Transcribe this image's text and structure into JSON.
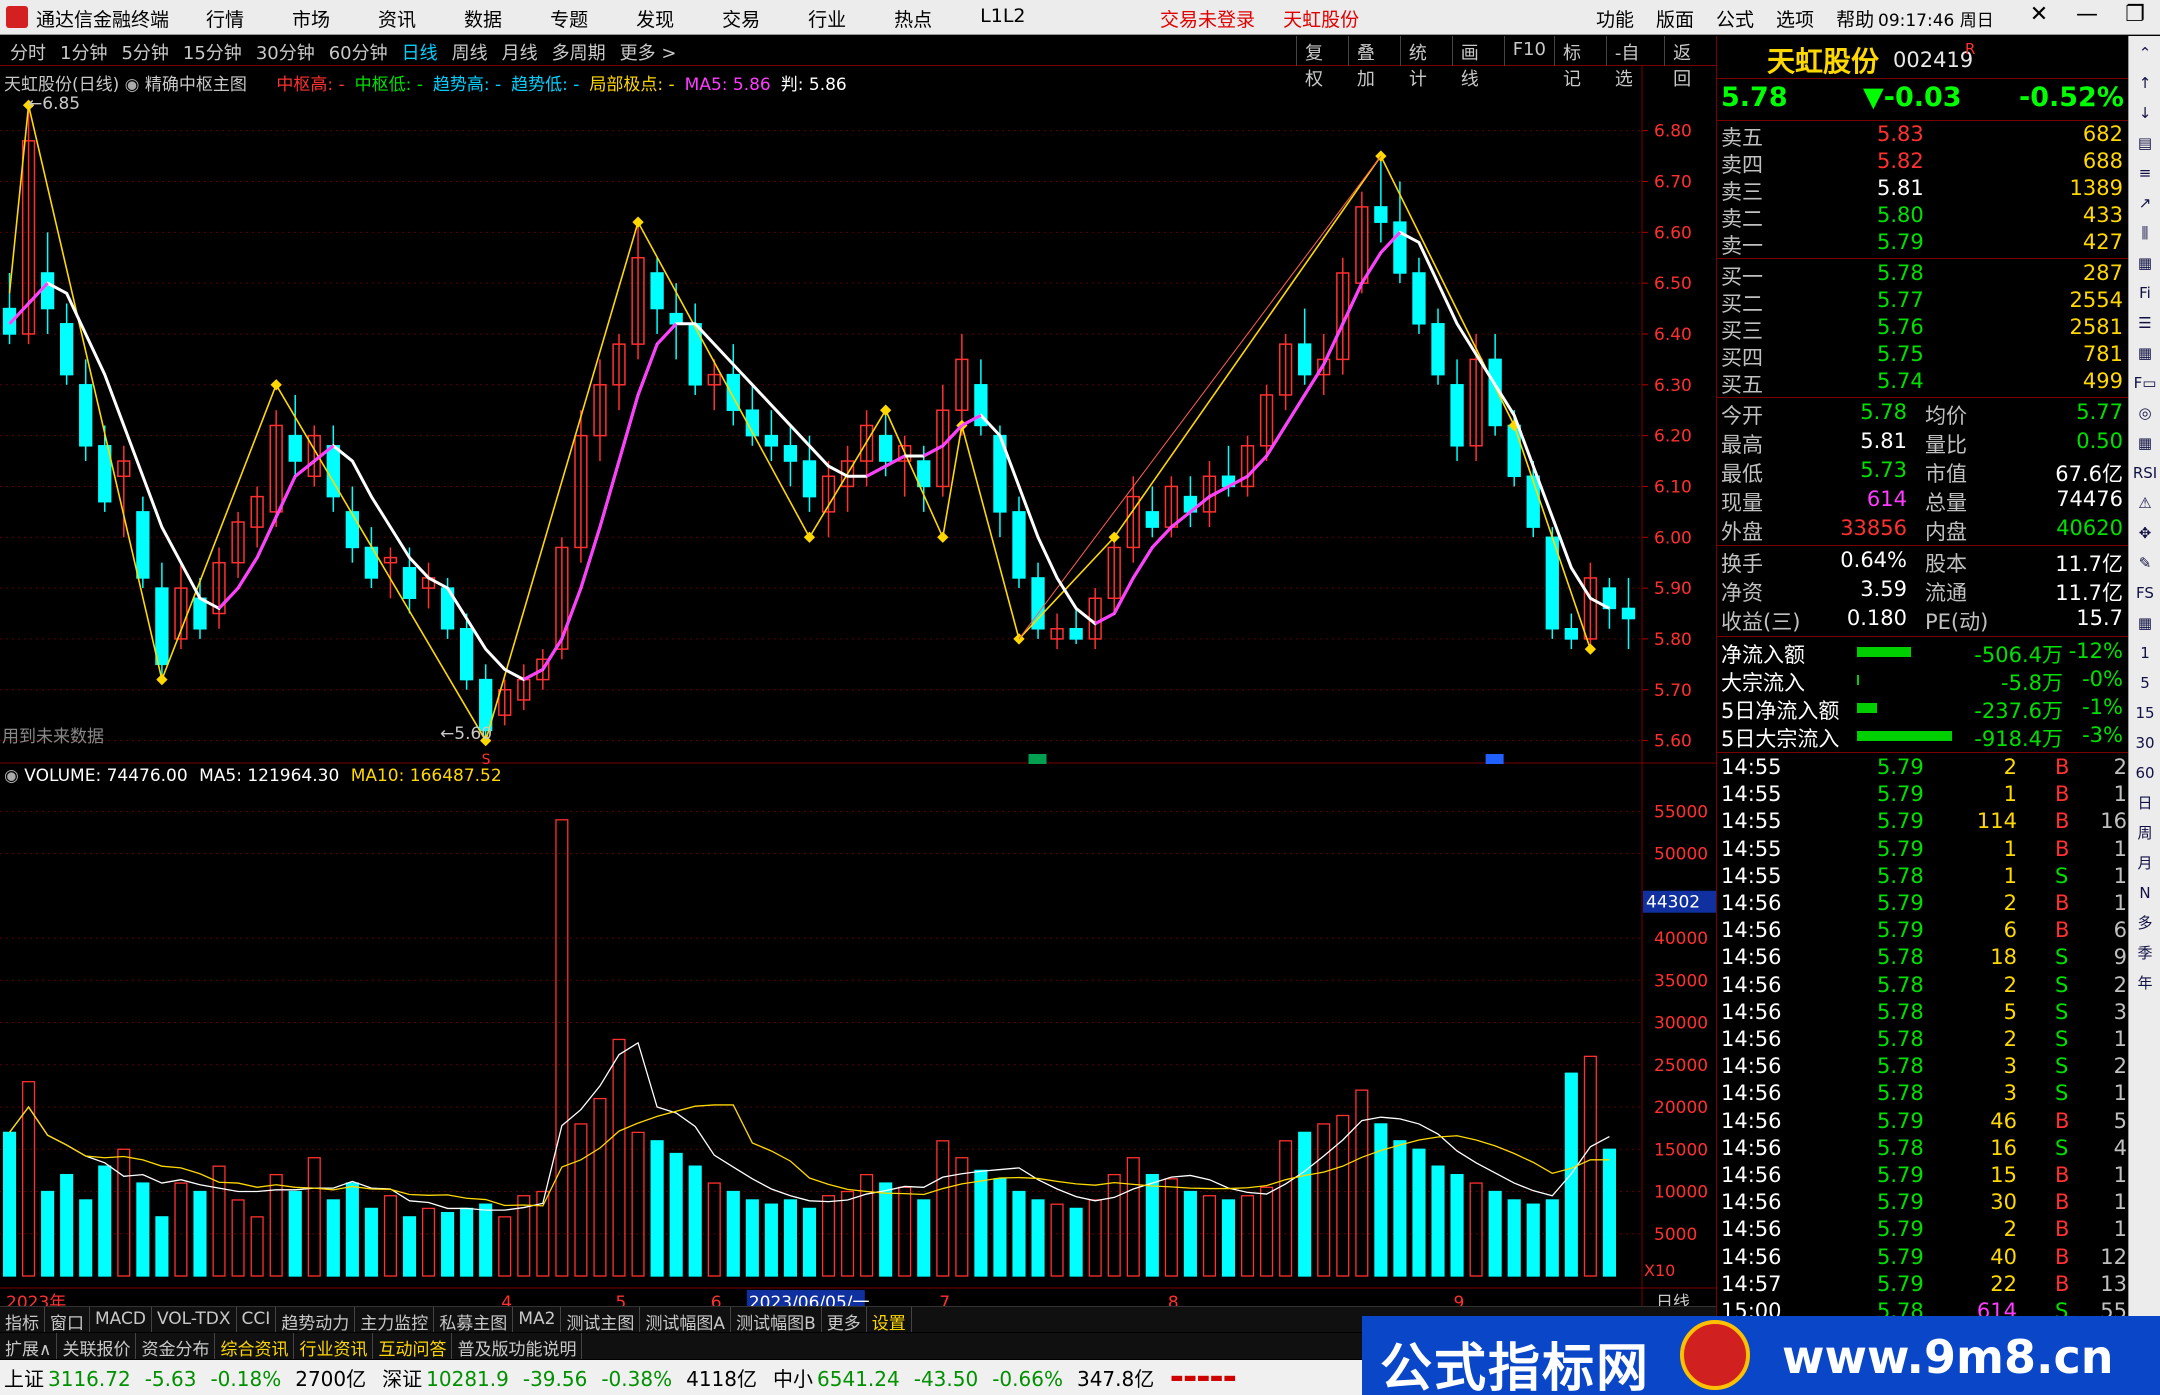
{
  "menubar": {
    "app_title": "通达信金融终端",
    "items": [
      "行情",
      "市场",
      "资讯",
      "数据",
      "专题",
      "发现",
      "交易",
      "行业",
      "热点",
      "L1L2"
    ],
    "status": [
      "交易未登录",
      "天虹股份"
    ],
    "right_items": [
      "功能",
      "版面",
      "公式",
      "选项",
      "帮助"
    ],
    "time": "09:17:46",
    "weekday": "周日",
    "window_controls": [
      "✕",
      "—",
      "❐",
      "✕"
    ]
  },
  "periodbar": {
    "periods": [
      "分时",
      "1分钟",
      "5分钟",
      "15分钟",
      "30分钟",
      "60分钟",
      "日线",
      "周线",
      "月线",
      "多周期",
      "更多 >"
    ],
    "active": "日线",
    "tools": [
      "复权",
      "叠加",
      "统计",
      "画线",
      "F10",
      "标记",
      "-自选",
      "返回"
    ]
  },
  "main_chart": {
    "stock_label": "天虹股份(日线)",
    "indicator_name": "精确中枢主图",
    "legend": [
      {
        "text": "中枢高: -",
        "color": "#ff3030"
      },
      {
        "text": "中枢低: -",
        "color": "#00e000"
      },
      {
        "text": "趋势高: -",
        "color": "#00d0ff"
      },
      {
        "text": "趋势低: -",
        "color": "#00d0ff"
      },
      {
        "text": "局部极点: -",
        "color": "#ffd800"
      },
      {
        "text": "MA5: 5.86",
        "color": "#ff3cff"
      },
      {
        "text": "判: 5.86",
        "color": "#ffffff"
      }
    ],
    "high_mark": "6.85",
    "low_mark": "5.60",
    "future_note": "用到未来数据",
    "price_ticks": [
      "6.80",
      "6.70",
      "6.60",
      "6.50",
      "6.40",
      "6.30",
      "6.20",
      "6.10",
      "6.00",
      "5.90",
      "5.80",
      "5.70",
      "5.60"
    ],
    "markers": [
      "S",
      "B",
      "B"
    ]
  },
  "volume_chart": {
    "label": "VOLUME: 74476.00",
    "ma5": "MA5: 121964.30",
    "ma10": "MA10: 166487.52",
    "vol_ticks": [
      "55000",
      "50000",
      "44302",
      "40000",
      "35000",
      "30000",
      "25000",
      "20000",
      "15000",
      "10000",
      "5000"
    ],
    "unit": "X10",
    "date_labels": [
      "2023年",
      "4",
      "5",
      "6",
      "2023/06/05/一",
      "7",
      "8",
      "9"
    ],
    "period_label": "日线"
  },
  "chart_data": {
    "type": "candlestick",
    "ylim": [
      5.55,
      6.88
    ],
    "candles": [
      [
        6.45,
        6.52,
        6.38,
        6.4
      ],
      [
        6.4,
        6.85,
        6.38,
        6.78
      ],
      [
        6.52,
        6.6,
        6.4,
        6.45
      ],
      [
        6.42,
        6.46,
        6.3,
        6.32
      ],
      [
        6.3,
        6.35,
        6.15,
        6.18
      ],
      [
        6.18,
        6.22,
        6.05,
        6.07
      ],
      [
        6.12,
        6.18,
        6.0,
        6.15
      ],
      [
        6.05,
        6.08,
        5.9,
        5.92
      ],
      [
        5.9,
        5.95,
        5.72,
        5.75
      ],
      [
        5.8,
        5.95,
        5.78,
        5.9
      ],
      [
        5.88,
        5.92,
        5.8,
        5.82
      ],
      [
        5.85,
        5.98,
        5.82,
        5.95
      ],
      [
        5.95,
        6.05,
        5.92,
        6.03
      ],
      [
        6.02,
        6.1,
        5.98,
        6.08
      ],
      [
        6.05,
        6.25,
        6.02,
        6.22
      ],
      [
        6.2,
        6.28,
        6.12,
        6.15
      ],
      [
        6.12,
        6.22,
        6.1,
        6.2
      ],
      [
        6.18,
        6.22,
        6.05,
        6.08
      ],
      [
        6.05,
        6.1,
        5.95,
        5.98
      ],
      [
        5.98,
        6.02,
        5.9,
        5.92
      ],
      [
        5.95,
        5.98,
        5.88,
        5.96
      ],
      [
        5.94,
        5.98,
        5.85,
        5.88
      ],
      [
        5.9,
        5.95,
        5.86,
        5.92
      ],
      [
        5.9,
        5.92,
        5.8,
        5.82
      ],
      [
        5.82,
        5.85,
        5.7,
        5.72
      ],
      [
        5.72,
        5.75,
        5.6,
        5.62
      ],
      [
        5.65,
        5.72,
        5.63,
        5.7
      ],
      [
        5.68,
        5.75,
        5.66,
        5.72
      ],
      [
        5.72,
        5.78,
        5.7,
        5.76
      ],
      [
        5.78,
        6.0,
        5.76,
        5.98
      ],
      [
        5.98,
        6.25,
        5.95,
        6.2
      ],
      [
        6.2,
        6.35,
        6.15,
        6.3
      ],
      [
        6.3,
        6.4,
        6.25,
        6.38
      ],
      [
        6.38,
        6.62,
        6.35,
        6.55
      ],
      [
        6.52,
        6.55,
        6.4,
        6.45
      ],
      [
        6.44,
        6.5,
        6.35,
        6.42
      ],
      [
        6.42,
        6.46,
        6.28,
        6.3
      ],
      [
        6.3,
        6.35,
        6.25,
        6.32
      ],
      [
        6.32,
        6.38,
        6.22,
        6.25
      ],
      [
        6.25,
        6.3,
        6.18,
        6.2
      ],
      [
        6.2,
        6.25,
        6.15,
        6.18
      ],
      [
        6.18,
        6.22,
        6.1,
        6.15
      ],
      [
        6.15,
        6.2,
        6.05,
        6.08
      ],
      [
        6.05,
        6.15,
        6.0,
        6.12
      ],
      [
        6.1,
        6.18,
        6.05,
        6.15
      ],
      [
        6.15,
        6.25,
        6.1,
        6.22
      ],
      [
        6.2,
        6.24,
        6.12,
        6.15
      ],
      [
        6.15,
        6.2,
        6.08,
        6.18
      ],
      [
        6.15,
        6.18,
        6.05,
        6.1
      ],
      [
        6.1,
        6.3,
        6.08,
        6.25
      ],
      [
        6.25,
        6.4,
        6.2,
        6.35
      ],
      [
        6.3,
        6.35,
        6.2,
        6.22
      ],
      [
        6.2,
        6.22,
        6.0,
        6.05
      ],
      [
        6.05,
        6.08,
        5.9,
        5.92
      ],
      [
        5.92,
        5.95,
        5.8,
        5.82
      ],
      [
        5.8,
        5.85,
        5.78,
        5.82
      ],
      [
        5.82,
        5.86,
        5.79,
        5.8
      ],
      [
        5.8,
        5.9,
        5.78,
        5.88
      ],
      [
        5.88,
        6.0,
        5.85,
        5.98
      ],
      [
        5.98,
        6.12,
        5.95,
        6.08
      ],
      [
        6.05,
        6.1,
        6.0,
        6.02
      ],
      [
        6.02,
        6.12,
        6.0,
        6.1
      ],
      [
        6.08,
        6.12,
        6.02,
        6.05
      ],
      [
        6.05,
        6.15,
        6.02,
        6.12
      ],
      [
        6.12,
        6.18,
        6.08,
        6.1
      ],
      [
        6.1,
        6.2,
        6.08,
        6.18
      ],
      [
        6.18,
        6.3,
        6.15,
        6.28
      ],
      [
        6.28,
        6.4,
        6.25,
        6.38
      ],
      [
        6.38,
        6.45,
        6.3,
        6.32
      ],
      [
        6.32,
        6.4,
        6.28,
        6.35
      ],
      [
        6.35,
        6.55,
        6.32,
        6.52
      ],
      [
        6.5,
        6.68,
        6.48,
        6.65
      ],
      [
        6.65,
        6.75,
        6.58,
        6.62
      ],
      [
        6.62,
        6.7,
        6.5,
        6.52
      ],
      [
        6.52,
        6.55,
        6.4,
        6.42
      ],
      [
        6.42,
        6.45,
        6.3,
        6.32
      ],
      [
        6.3,
        6.35,
        6.15,
        6.18
      ],
      [
        6.18,
        6.4,
        6.15,
        6.35
      ],
      [
        6.35,
        6.4,
        6.2,
        6.22
      ],
      [
        6.22,
        6.25,
        6.1,
        6.12
      ],
      [
        6.12,
        6.15,
        6.0,
        6.02
      ],
      [
        6.0,
        6.02,
        5.8,
        5.82
      ],
      [
        5.82,
        5.85,
        5.78,
        5.8
      ],
      [
        5.8,
        5.95,
        5.78,
        5.92
      ],
      [
        5.9,
        5.92,
        5.82,
        5.86
      ],
      [
        5.86,
        5.92,
        5.78,
        5.84
      ]
    ],
    "ma5": [
      6.42,
      6.46,
      6.5,
      6.48,
      6.4,
      6.32,
      6.22,
      6.12,
      6.02,
      5.95,
      5.88,
      5.86,
      5.9,
      5.96,
      6.04,
      6.12,
      6.15,
      6.18,
      6.15,
      6.08,
      6.02,
      5.96,
      5.92,
      5.9,
      5.84,
      5.78,
      5.74,
      5.72,
      5.74,
      5.8,
      5.9,
      6.02,
      6.15,
      6.28,
      6.38,
      6.42,
      6.42,
      6.38,
      6.34,
      6.3,
      6.26,
      6.22,
      6.18,
      6.14,
      6.12,
      6.12,
      6.14,
      6.16,
      6.16,
      6.18,
      6.22,
      6.24,
      6.2,
      6.1,
      6.0,
      5.92,
      5.86,
      5.83,
      5.85,
      5.92,
      5.98,
      6.02,
      6.05,
      6.08,
      6.1,
      6.12,
      6.16,
      6.22,
      6.28,
      6.34,
      6.42,
      6.5,
      6.56,
      6.6,
      6.58,
      6.5,
      6.42,
      6.36,
      6.3,
      6.24,
      6.14,
      6.04,
      5.94,
      5.88,
      5.86
    ],
    "volume": [
      17000,
      23000,
      10000,
      12000,
      9000,
      13000,
      15000,
      11000,
      7000,
      11000,
      10000,
      13000,
      9000,
      7000,
      12000,
      10000,
      14000,
      9000,
      11000,
      8000,
      9500,
      7000,
      8000,
      7500,
      8000,
      8500,
      7000,
      9500,
      10000,
      54000,
      18000,
      21000,
      28000,
      17000,
      16000,
      14500,
      13000,
      11000,
      10000,
      9000,
      8500,
      9000,
      8000,
      9500,
      10000,
      12000,
      11000,
      10500,
      9000,
      16000,
      14000,
      12500,
      11500,
      10000,
      9000,
      8500,
      8000,
      9000,
      12000,
      14000,
      12000,
      11500,
      10000,
      9500,
      9000,
      9500,
      10500,
      16000,
      17000,
      18000,
      19000,
      22000,
      18000,
      16000,
      15000,
      13000,
      12000,
      11000,
      10000,
      9000,
      8500,
      9000,
      24000,
      26000,
      15000
    ]
  },
  "quote": {
    "name": "天虹股份",
    "code": "002419",
    "flag": "R",
    "price": "5.78",
    "change": "▼-0.03",
    "pct": "-0.52%",
    "asks": [
      {
        "label": "卖五",
        "price": "5.83",
        "vol": "682"
      },
      {
        "label": "卖四",
        "price": "5.82",
        "vol": "688"
      },
      {
        "label": "卖三",
        "price": "5.81",
        "vol": "1389"
      },
      {
        "label": "卖二",
        "price": "5.80",
        "vol": "433"
      },
      {
        "label": "卖一",
        "price": "5.79",
        "vol": "427"
      }
    ],
    "bids": [
      {
        "label": "买一",
        "price": "5.78",
        "vol": "287"
      },
      {
        "label": "买二",
        "price": "5.77",
        "vol": "2554"
      },
      {
        "label": "买三",
        "price": "5.76",
        "vol": "2581"
      },
      {
        "label": "买四",
        "price": "5.75",
        "vol": "781"
      },
      {
        "label": "买五",
        "price": "5.74",
        "vol": "499"
      }
    ],
    "stats": [
      {
        "l1": "今开",
        "v1": "5.78",
        "l2": "均价",
        "v2": "5.77"
      },
      {
        "l1": "最高",
        "v1": "5.81",
        "l2": "量比",
        "v2": "0.50"
      },
      {
        "l1": "最低",
        "v1": "5.73",
        "l2": "市值",
        "v2": "67.6亿"
      },
      {
        "l1": "现量",
        "v1": "614",
        "l2": "总量",
        "v2": "74476"
      },
      {
        "l1": "外盘",
        "v1": "33856",
        "l2": "内盘",
        "v2": "40620"
      }
    ],
    "stats2": [
      {
        "l1": "换手",
        "v1": "0.64%",
        "l2": "股本",
        "v2": "11.7亿"
      },
      {
        "l1": "净资",
        "v1": "3.59",
        "l2": "流通",
        "v2": "11.7亿"
      },
      {
        "l1": "收益(三)",
        "v1": "0.180",
        "l2": "PE(动)",
        "v2": "15.7"
      }
    ],
    "flows": [
      {
        "label": "净流入额",
        "val": "-506.4万",
        "pct": "-12%",
        "bar": 0.36
      },
      {
        "label": "大宗流入",
        "val": "-5.8万",
        "pct": "-0%",
        "bar": 0.01
      },
      {
        "label": "5日净流入额",
        "val": "-237.6万",
        "pct": "-1%",
        "bar": 0.13
      },
      {
        "label": "5日大宗流入",
        "val": "-918.4万",
        "pct": "-3%",
        "bar": 0.63
      }
    ],
    "ticks": [
      [
        "14:55",
        "5.79",
        "2",
        "B",
        "2"
      ],
      [
        "14:55",
        "5.79",
        "1",
        "B",
        "1"
      ],
      [
        "14:55",
        "5.79",
        "114",
        "B",
        "16"
      ],
      [
        "14:55",
        "5.79",
        "1",
        "B",
        "1"
      ],
      [
        "14:55",
        "5.78",
        "1",
        "S",
        "1"
      ],
      [
        "14:56",
        "5.79",
        "2",
        "B",
        "1"
      ],
      [
        "14:56",
        "5.79",
        "6",
        "B",
        "6"
      ],
      [
        "14:56",
        "5.78",
        "18",
        "S",
        "9"
      ],
      [
        "14:56",
        "5.78",
        "2",
        "S",
        "2"
      ],
      [
        "14:56",
        "5.78",
        "5",
        "S",
        "3"
      ],
      [
        "14:56",
        "5.78",
        "2",
        "S",
        "1"
      ],
      [
        "14:56",
        "5.78",
        "3",
        "S",
        "2"
      ],
      [
        "14:56",
        "5.78",
        "3",
        "S",
        "1"
      ],
      [
        "14:56",
        "5.79",
        "46",
        "B",
        "5"
      ],
      [
        "14:56",
        "5.78",
        "16",
        "S",
        "4"
      ],
      [
        "14:56",
        "5.79",
        "15",
        "B",
        "1"
      ],
      [
        "14:56",
        "5.79",
        "30",
        "B",
        "1"
      ],
      [
        "14:56",
        "5.79",
        "2",
        "B",
        "1"
      ],
      [
        "14:56",
        "5.79",
        "40",
        "B",
        "12"
      ],
      [
        "14:57",
        "5.79",
        "22",
        "B",
        "13"
      ],
      [
        "15:00",
        "5.78",
        "614",
        "S",
        "55"
      ]
    ]
  },
  "tabs1": [
    "指标",
    "窗口",
    "MACD",
    "VOL-TDX",
    "CCI",
    "趋势动力",
    "主力监控",
    "私募主图",
    "MA2",
    "测试主图",
    "测试幅图A",
    "测试幅图B",
    "更多",
    "设置"
  ],
  "tabs2": [
    "扩展∧",
    "关联报价",
    "资金分布",
    "综合资讯",
    "行业资讯",
    "互动问答",
    "普及版功能说明"
  ],
  "indices": [
    {
      "name": "上证",
      "val": "3116.72",
      "chg": "-5.63",
      "pct": "-0.18%",
      "amt": "2700亿"
    },
    {
      "name": "深证",
      "val": "10281.9",
      "chg": "-39.56",
      "pct": "-0.38%",
      "amt": "4118亿"
    },
    {
      "name": "中小",
      "val": "6541.24",
      "chg": "-43.50",
      "pct": "-0.66%",
      "amt": "347.8亿"
    }
  ],
  "toolcol": [
    "⌃",
    "↑",
    "↓",
    "▤",
    "≡",
    "↗",
    "⫼",
    "▦",
    "Fi",
    "☰",
    "▦",
    "F▭",
    "◎",
    "▦",
    "RSI",
    "⚠",
    "✥",
    "✎",
    "FS",
    "▦",
    "1",
    "5",
    "15",
    "30",
    "60",
    "日",
    "周",
    "月",
    "N",
    "多",
    "季",
    "年"
  ],
  "watermark": {
    "text1": "公式指标网",
    "text2": "www.9m8.cn"
  },
  "colors": {
    "up": "#ff3030",
    "down": "#00ffff",
    "ma5": "#ff3cff",
    "ma_white": "#ffffff",
    "zigzag": "#ffd800",
    "grid": "#7a0000"
  }
}
